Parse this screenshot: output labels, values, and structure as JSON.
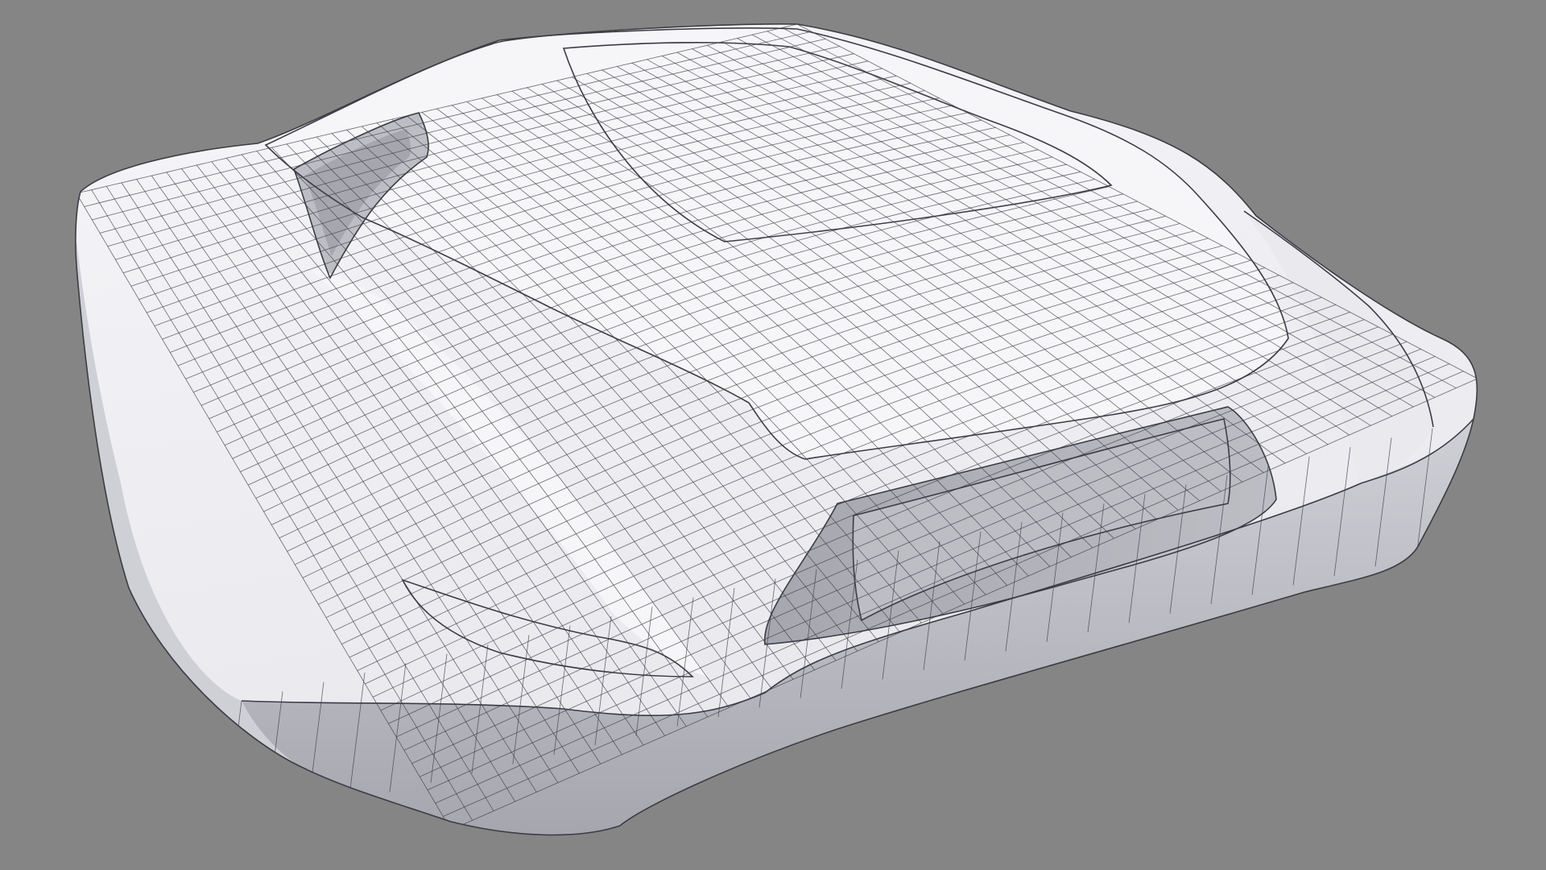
{
  "viewport": {
    "background_color": "#858585",
    "subject": {
      "icon": "wireframe-mesh-icon",
      "surface_color": "#e9e9ee",
      "surface_highlight": "#f6f6f9",
      "surface_shadow": "#a6a6ae",
      "side_color": "#cfd0d6",
      "recess_color": "#bdbec4",
      "wire_color": "#3c3c44"
    }
  }
}
